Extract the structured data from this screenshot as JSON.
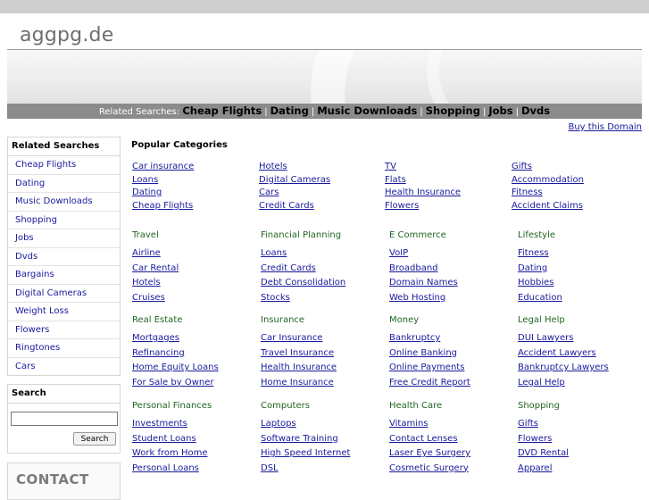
{
  "site": {
    "name": "aggpg.de"
  },
  "related_bar": {
    "prefix": "Related Searches:",
    "items": [
      "Cheap Flights",
      "Dating",
      "Music Downloads",
      "Shopping",
      "Jobs",
      "Dvds"
    ],
    "separator": "|"
  },
  "buy_link": "Buy this Domain",
  "sidebar": {
    "title": "Related Searches",
    "items": [
      "Cheap Flights",
      "Dating",
      "Music Downloads",
      "Shopping",
      "Jobs",
      "Dvds",
      "Bargains",
      "Digital Cameras",
      "Weight Loss",
      "Flowers",
      "Ringtones",
      "Cars"
    ]
  },
  "search": {
    "title": "Search",
    "value": "",
    "button_label": "Search"
  },
  "contact": {
    "label": "CONTACT"
  },
  "popular": {
    "title": "Popular Categories",
    "columns": [
      [
        "Car insurance",
        "Loans",
        "Dating",
        "Cheap Flights"
      ],
      [
        "Hotels",
        "Digital Cameras",
        "Cars",
        "Credit Cards"
      ],
      [
        "TV",
        "Flats",
        "Health Insurance",
        "Flowers"
      ],
      [
        "Gifts",
        "Accommodation",
        "Fitness",
        "Accident Claims"
      ]
    ]
  },
  "categories": [
    {
      "title": "Travel",
      "links": [
        "Airline",
        "Car Rental",
        "Hotels",
        "Cruises"
      ]
    },
    {
      "title": "Financial Planning",
      "links": [
        "Loans",
        "Credit Cards",
        "Debt Consolidation",
        "Stocks"
      ]
    },
    {
      "title": "E Commerce",
      "links": [
        "VoIP",
        "Broadband",
        "Domain Names",
        "Web Hosting"
      ]
    },
    {
      "title": "Lifestyle",
      "links": [
        "Fitness",
        "Dating",
        "Hobbies",
        "Education"
      ]
    },
    {
      "title": "Real Estate",
      "links": [
        "Mortgages",
        "Refinancing",
        "Home Equity Loans",
        "For Sale by Owner"
      ]
    },
    {
      "title": "Insurance",
      "links": [
        "Car Insurance",
        "Travel Insurance",
        "Health Insurance",
        "Home Insurance"
      ]
    },
    {
      "title": "Money",
      "links": [
        "Bankruptcy",
        "Online Banking",
        "Online Payments",
        "Free Credit Report"
      ]
    },
    {
      "title": "Legal Help",
      "links": [
        "DUI Lawyers",
        "Accident Lawyers",
        "Bankruptcy Lawyers",
        "Legal Help"
      ]
    },
    {
      "title": "Personal Finances",
      "links": [
        "Investments",
        "Student Loans",
        "Work from Home",
        "Personal Loans"
      ]
    },
    {
      "title": "Computers",
      "links": [
        "Laptops",
        "Software Training",
        "High Speed Internet",
        "DSL"
      ]
    },
    {
      "title": "Health Care",
      "links": [
        "Vitamins",
        "Contact Lenses",
        "Laser Eye Surgery",
        "Cosmetic Surgery"
      ]
    },
    {
      "title": "Shopping",
      "links": [
        "Gifts",
        "Flowers",
        "DVD Rental",
        "Apparel"
      ]
    }
  ]
}
